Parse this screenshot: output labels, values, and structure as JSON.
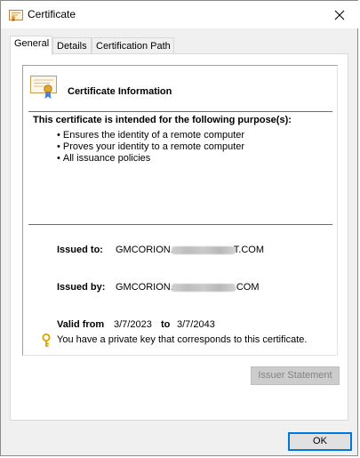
{
  "window": {
    "title": "Certificate",
    "close_label": "Close"
  },
  "tabs": [
    {
      "label": "General",
      "active": true
    },
    {
      "label": "Details",
      "active": false
    },
    {
      "label": "Certification Path",
      "active": false
    }
  ],
  "general": {
    "heading": "Certificate Information",
    "purpose_title": "This certificate is intended for the following purpose(s):",
    "purposes": [
      "Ensures the identity of a remote computer",
      "Proves your identity to a remote computer",
      "All issuance policies"
    ],
    "issued_to_label": "Issued to:",
    "issued_to_prefix": "GMCORION.",
    "issued_to_suffix": "T.COM",
    "issued_by_label": "Issued by:",
    "issued_by_prefix": "GMCORION.",
    "issued_by_suffix": ".COM",
    "valid_from_label": "Valid from",
    "valid_from": "3/7/2023",
    "valid_to_label": "to",
    "valid_to": "3/7/2043",
    "private_key_text": "You have a private key that corresponds to this certificate."
  },
  "buttons": {
    "issuer_statement": "Issuer Statement",
    "ok": "OK"
  },
  "colors": {
    "accent": "#0078d7",
    "key_gold": "#d8a300"
  }
}
